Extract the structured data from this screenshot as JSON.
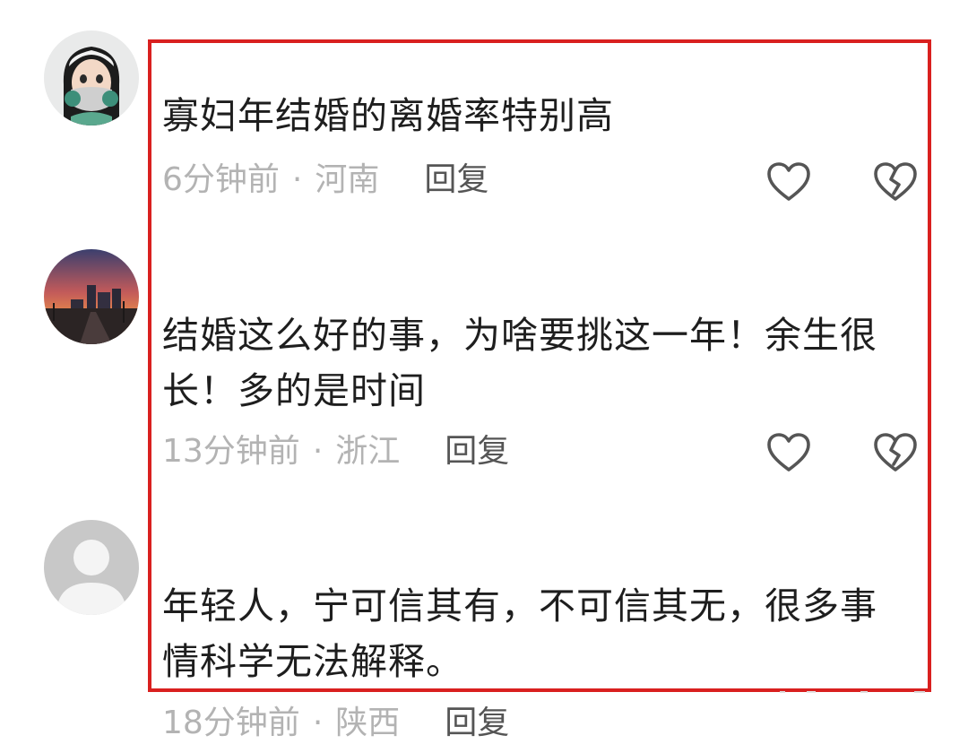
{
  "comments": [
    {
      "avatar": "avatar-cartoon-girl-with-mask",
      "text": "寡妇年结婚的离婚率特别高",
      "time": "6分钟前",
      "separator": "·",
      "location": "河南",
      "reply_label": "回复"
    },
    {
      "avatar": "avatar-sunset-city",
      "text": "结婚这么好的事，为啥要挑这一年！余生很长！多的是时间",
      "time": "13分钟前",
      "separator": "·",
      "location": "浙江",
      "reply_label": "回复"
    },
    {
      "avatar": "avatar-default-gray",
      "text": "年轻人，宁可信其有，不可信其无，很多事情科学无法解释。",
      "time": "18分钟前",
      "separator": "·",
      "location": "陕西",
      "reply_label": "回复"
    }
  ],
  "icons": {
    "like": "heart-outline-icon",
    "dislike": "broken-heart-icon"
  },
  "colors": {
    "highlight_border": "#d9201f",
    "text": "#1e1e1e",
    "meta": "#b3b3b3",
    "reply": "#555555",
    "icon": "#555555"
  }
}
